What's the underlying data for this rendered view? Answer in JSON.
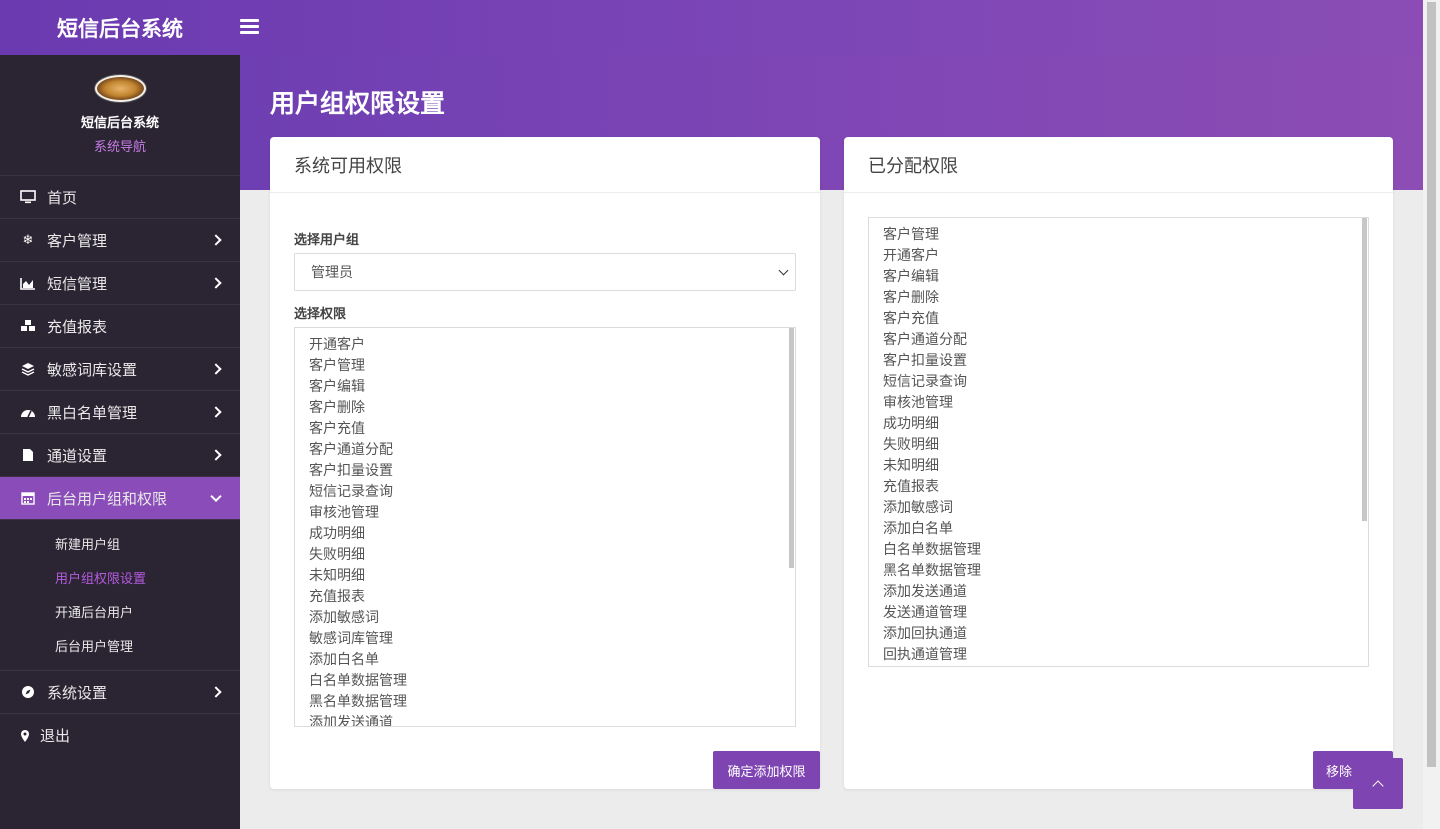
{
  "app": {
    "brand": "短信后台系统"
  },
  "sidebar": {
    "profile": {
      "name": "短信后台系统",
      "subtitle": "系统导航"
    },
    "items": [
      {
        "label": "首页",
        "icon": "monitor-icon"
      },
      {
        "label": "客户管理",
        "icon": "snowflake-icon"
      },
      {
        "label": "短信管理",
        "icon": "area-chart-icon"
      },
      {
        "label": "充值报表",
        "icon": "cubes-icon"
      },
      {
        "label": "敏感词库设置",
        "icon": "layers-icon"
      },
      {
        "label": "黑白名单管理",
        "icon": "dashboard-icon"
      },
      {
        "label": "通道设置",
        "icon": "file-icon"
      },
      {
        "label": "后台用户组和权限",
        "icon": "calendar-icon"
      },
      {
        "label": "系统设置",
        "icon": "compass-icon"
      },
      {
        "label": "退出",
        "icon": "map-marker-icon"
      }
    ],
    "sub_items": [
      "新建用户组",
      "用户组权限设置",
      "开通后台用户",
      "后台用户管理"
    ]
  },
  "page": {
    "title": "用户组权限设置"
  },
  "left_card": {
    "title": "系统可用权限",
    "group_label": "选择用户组",
    "group_selected": "管理员",
    "perm_label": "选择权限",
    "permissions": [
      "开通客户",
      "客户管理",
      "客户编辑",
      "客户删除",
      "客户充值",
      "客户通道分配",
      "客户扣量设置",
      "短信记录查询",
      "审核池管理",
      "成功明细",
      "失败明细",
      "未知明细",
      "充值报表",
      "添加敏感词",
      "敏感词库管理",
      "添加白名单",
      "白名单数据管理",
      "黑名单数据管理",
      "添加发送通道"
    ],
    "submit_label": "确定添加权限"
  },
  "right_card": {
    "title": "已分配权限",
    "permissions": [
      "客户管理",
      "开通客户",
      "客户编辑",
      "客户删除",
      "客户充值",
      "客户通道分配",
      "客户扣量设置",
      "短信记录查询",
      "审核池管理",
      "成功明细",
      "失败明细",
      "未知明细",
      "充值报表",
      "添加敏感词",
      "添加白名单",
      "白名单数据管理",
      "黑名单数据管理",
      "添加发送通道",
      "发送通道管理",
      "添加回执通道",
      "回执通道管理"
    ],
    "remove_label": "移除"
  },
  "icons": {
    "menu": "hamburger-icon",
    "back_to_top": "chevron-up-icon"
  },
  "colors": {
    "accent": "#7d44b2",
    "sidebar_bg": "#2b2433",
    "active_item": "#8a4cb8",
    "current_sub": "#b45be0"
  }
}
